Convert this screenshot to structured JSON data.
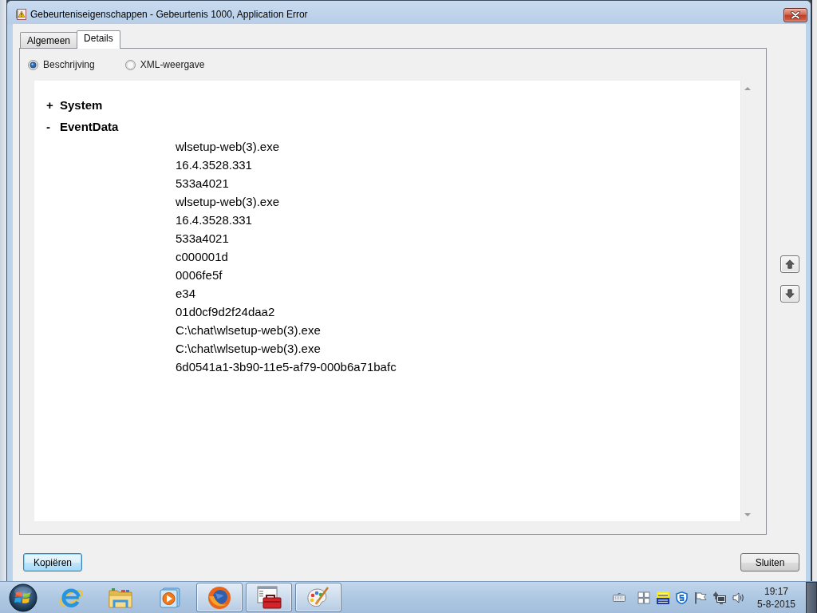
{
  "window": {
    "title": "Gebeurteniseigenschappen - Gebeurtenis 1000, Application Error"
  },
  "tabs": [
    {
      "label": "Algemeen",
      "selected": false
    },
    {
      "label": "Details",
      "selected": true
    }
  ],
  "view_options": [
    {
      "label": "Beschrijving",
      "selected": true
    },
    {
      "label": "XML-weergave",
      "selected": false
    }
  ],
  "details_tree": [
    {
      "toggle": "+",
      "label": "System"
    },
    {
      "toggle": "-",
      "label": "EventData",
      "values": [
        "wlsetup-web(3).exe",
        "16.4.3528.331",
        "533a4021",
        "wlsetup-web(3).exe",
        "16.4.3528.331",
        "533a4021",
        "c000001d",
        "0006fe5f",
        "e34",
        "01d0cf9d2f24daa2",
        "C:\\chat\\wlsetup-web(3).exe",
        "C:\\chat\\wlsetup-web(3).exe",
        "6d0541a1-3b90-11e5-af79-000b6a71bafc"
      ]
    }
  ],
  "buttons": [
    {
      "label": "Kopiëren",
      "default": true
    },
    {
      "label": "Sluiten",
      "default": false
    }
  ],
  "taskbar": {
    "apps": [
      {
        "running": false
      },
      {
        "running": false
      },
      {
        "running": false
      },
      {
        "running": true
      },
      {
        "running": true
      },
      {
        "running": true
      }
    ],
    "clock": {
      "time": "19:17",
      "date": "5-8-2015"
    }
  }
}
